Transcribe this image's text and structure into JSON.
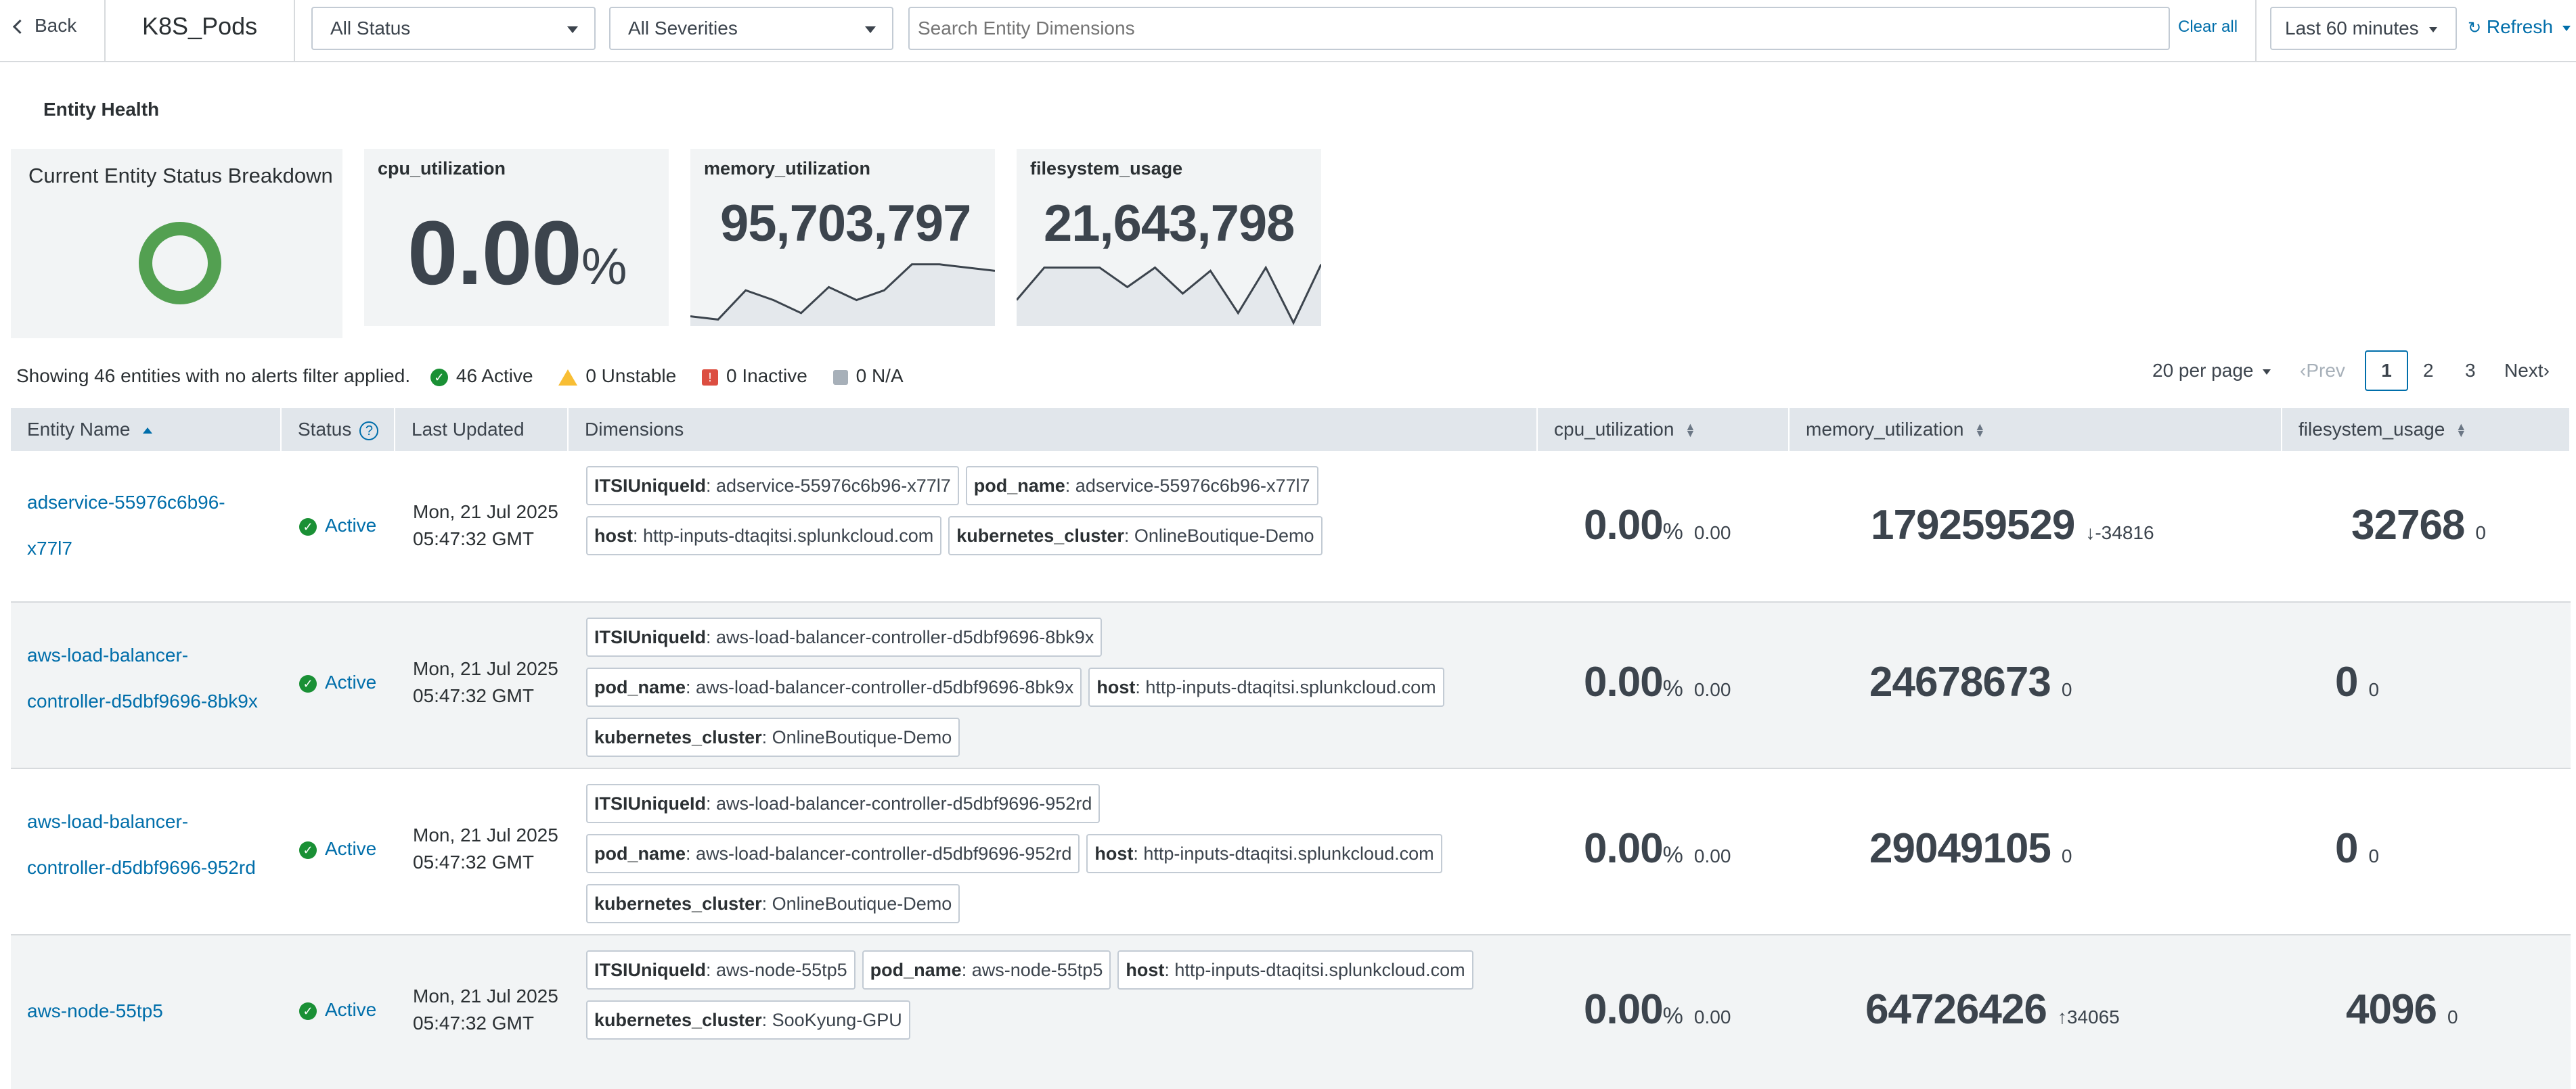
{
  "header": {
    "back_label": "Back",
    "title": "K8S_Pods",
    "status_filter": "All Status",
    "severity_filter": "All Severities",
    "search_placeholder": "Search Entity Dimensions",
    "clear_all": "Clear all",
    "time_range": "Last 60 minutes",
    "refresh": "Refresh"
  },
  "section_title": "Entity Health",
  "tiles": {
    "status": {
      "title": "Current Entity Status Breakdown"
    },
    "cpu": {
      "title": "cpu_utilization",
      "value": "0.00",
      "unit": "%"
    },
    "memory": {
      "title": "memory_utilization",
      "value": "95,703,797",
      "sparkline": [
        0.15,
        0.1,
        0.55,
        0.4,
        0.2,
        0.6,
        0.4,
        0.55,
        0.95,
        0.95,
        0.9,
        0.85
      ]
    },
    "filesystem": {
      "title": "filesystem_usage",
      "value": "21,643,798",
      "sparkline": [
        0.4,
        0.9,
        0.9,
        0.9,
        0.6,
        0.9,
        0.5,
        0.85,
        0.2,
        0.9,
        0.05,
        0.95
      ]
    }
  },
  "summary": {
    "showing": "Showing 46 entities with no alerts filter applied.",
    "active": "46 Active",
    "unstable": "0 Unstable",
    "inactive": "0 Inactive",
    "na": "0 N/A"
  },
  "pagination": {
    "per_page": "20 per page",
    "prev": "Prev",
    "pages": [
      "1",
      "2",
      "3"
    ],
    "next": "Next",
    "current": "1"
  },
  "columns": [
    "Entity Name",
    "Status",
    "Last Updated",
    "Dimensions",
    "cpu_utilization",
    "memory_utilization",
    "filesystem_usage"
  ],
  "rows": [
    {
      "name_line1": "adservice-55976c6b96-",
      "name_line2": "x77l7",
      "status": "Active",
      "updated_date": "Mon, 21 Jul 2025",
      "updated_time": "05:47:32 GMT",
      "dims": [
        [
          {
            "k": "ITSIUniqueId",
            "v": "adservice-55976c6b96-x77l7"
          },
          {
            "k": "pod_name",
            "v": "adservice-55976c6b96-x77l7"
          }
        ],
        [
          {
            "k": "host",
            "v": "http-inputs-dtaqitsi.splunkcloud.com"
          },
          {
            "k": "kubernetes_cluster",
            "v": "OnlineBoutique-Demo"
          }
        ]
      ],
      "cpu": "0.00",
      "cpu_unit": "%",
      "cpu_change": "0.00",
      "mem": "179259529",
      "mem_arrow": "↓",
      "mem_change": "-34816",
      "fs": "32768",
      "fs_change": "0"
    },
    {
      "name_line1": "aws-load-balancer-",
      "name_line2": "controller-d5dbf9696-8bk9x",
      "status": "Active",
      "updated_date": "Mon, 21 Jul 2025",
      "updated_time": "05:47:32 GMT",
      "dims": [
        [
          {
            "k": "ITSIUniqueId",
            "v": "aws-load-balancer-controller-d5dbf9696-8bk9x"
          }
        ],
        [
          {
            "k": "pod_name",
            "v": "aws-load-balancer-controller-d5dbf9696-8bk9x"
          },
          {
            "k": "host",
            "v": "http-inputs-dtaqitsi.splunkcloud.com"
          }
        ],
        [
          {
            "k": "kubernetes_cluster",
            "v": "OnlineBoutique-Demo"
          }
        ]
      ],
      "cpu": "0.00",
      "cpu_unit": "%",
      "cpu_change": "0.00",
      "mem": "24678673",
      "mem_arrow": "",
      "mem_change": "0",
      "fs": "0",
      "fs_change": "0"
    },
    {
      "name_line1": "aws-load-balancer-",
      "name_line2": "controller-d5dbf9696-952rd",
      "status": "Active",
      "updated_date": "Mon, 21 Jul 2025",
      "updated_time": "05:47:32 GMT",
      "dims": [
        [
          {
            "k": "ITSIUniqueId",
            "v": "aws-load-balancer-controller-d5dbf9696-952rd"
          }
        ],
        [
          {
            "k": "pod_name",
            "v": "aws-load-balancer-controller-d5dbf9696-952rd"
          },
          {
            "k": "host",
            "v": "http-inputs-dtaqitsi.splunkcloud.com"
          }
        ],
        [
          {
            "k": "kubernetes_cluster",
            "v": "OnlineBoutique-Demo"
          }
        ]
      ],
      "cpu": "0.00",
      "cpu_unit": "%",
      "cpu_change": "0.00",
      "mem": "29049105",
      "mem_arrow": "",
      "mem_change": "0",
      "fs": "0",
      "fs_change": "0"
    },
    {
      "name_line1": "aws-node-55tp5",
      "name_line2": "",
      "status": "Active",
      "updated_date": "Mon, 21 Jul 2025",
      "updated_time": "05:47:32 GMT",
      "dims": [
        [
          {
            "k": "ITSIUniqueId",
            "v": "aws-node-55tp5"
          },
          {
            "k": "pod_name",
            "v": "aws-node-55tp5"
          },
          {
            "k": "host",
            "v": "http-inputs-dtaqitsi.splunkcloud.com"
          }
        ],
        [
          {
            "k": "kubernetes_cluster",
            "v": "SooKyung-GPU"
          }
        ]
      ],
      "cpu": "0.00",
      "cpu_unit": "%",
      "cpu_change": "0.00",
      "mem": "64726426",
      "mem_arrow": "↑",
      "mem_change": "34065",
      "fs": "4096",
      "fs_change": "0"
    }
  ],
  "colors": {
    "link": "#006eaa",
    "active": "#1a9035",
    "unstable": "#f8be34",
    "inactive": "#dc4e41",
    "na": "#a7b0b9",
    "donut": "#53a051"
  }
}
